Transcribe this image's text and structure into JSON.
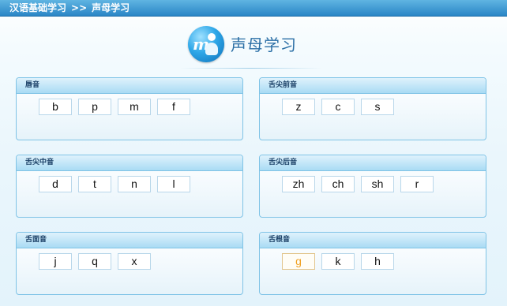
{
  "breadcrumb": {
    "parent": "汉语基础学习",
    "separator": ">>",
    "current": "声母学习"
  },
  "page_title": "声母学习",
  "groups": [
    {
      "title": "唇音",
      "letters": [
        "b",
        "p",
        "m",
        "f"
      ]
    },
    {
      "title": "舌尖前音",
      "letters": [
        "z",
        "c",
        "s"
      ]
    },
    {
      "title": "舌尖中音",
      "letters": [
        "d",
        "t",
        "n",
        "l"
      ]
    },
    {
      "title": "舌尖后音",
      "letters": [
        "zh",
        "ch",
        "sh",
        "r"
      ]
    },
    {
      "title": "舌面音",
      "letters": [
        "j",
        "q",
        "x"
      ]
    },
    {
      "title": "舌根音",
      "letters": [
        "g",
        "k",
        "h"
      ]
    }
  ],
  "highlighted_letter": "g",
  "colors": {
    "topbar": "#2a86c6",
    "title": "#2b6fa6",
    "highlight": "#f0a020",
    "panel_border": "#7fc3e6"
  }
}
